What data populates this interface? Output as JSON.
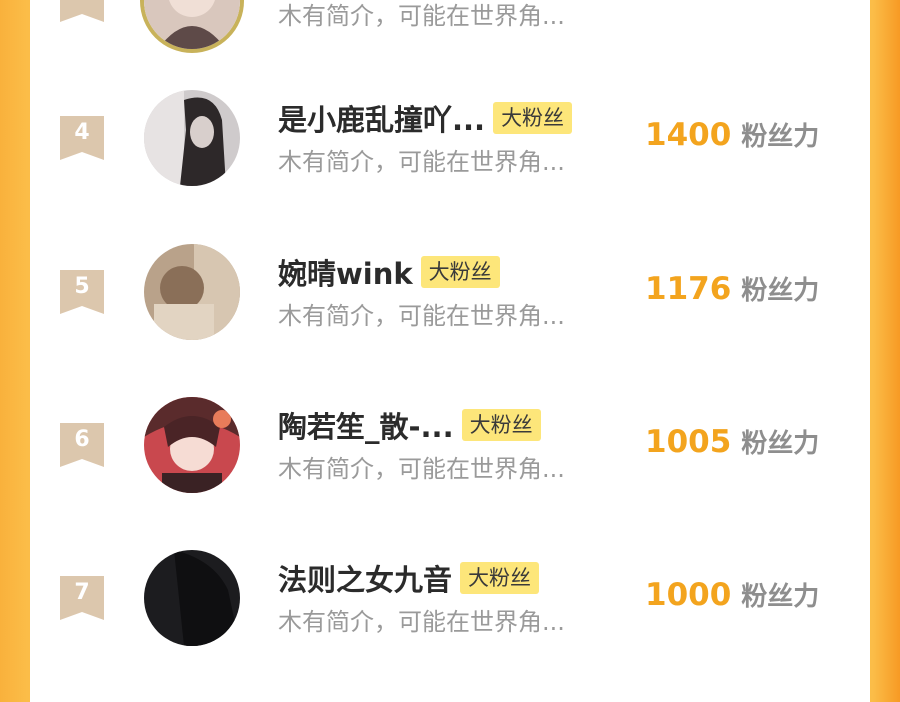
{
  "colors": {
    "frame_orange": "#fbbd48",
    "score_orange": "#f3a41e",
    "badge_yellow": "#fde67a",
    "rank_tag_tan": "#dcc7ad"
  },
  "rows": [
    {
      "rank": "",
      "name": "",
      "badge": "",
      "intro": "木有简介，可能在世界角...",
      "score": "",
      "unit": "",
      "avatar_icon": "user-avatar-icon"
    },
    {
      "rank": "4",
      "name": "是小鹿乱撞吖...",
      "badge": "大粉丝",
      "intro": "木有简介，可能在世界角...",
      "score": "1400",
      "unit": "粉丝力",
      "avatar_icon": "user-avatar-icon"
    },
    {
      "rank": "5",
      "name": "婉晴wink",
      "badge": "大粉丝",
      "intro": "木有简介，可能在世界角...",
      "score": "1176",
      "unit": "粉丝力",
      "avatar_icon": "user-avatar-icon"
    },
    {
      "rank": "6",
      "name": "陶若笙_散-...",
      "badge": "大粉丝",
      "intro": "木有简介，可能在世界角...",
      "score": "1005",
      "unit": "粉丝力",
      "avatar_icon": "user-avatar-icon"
    },
    {
      "rank": "7",
      "name": "法则之女九音",
      "badge": "大粉丝",
      "intro": "木有简介，可能在世界角...",
      "score": "1000",
      "unit": "粉丝力",
      "avatar_icon": "user-avatar-icon"
    }
  ]
}
